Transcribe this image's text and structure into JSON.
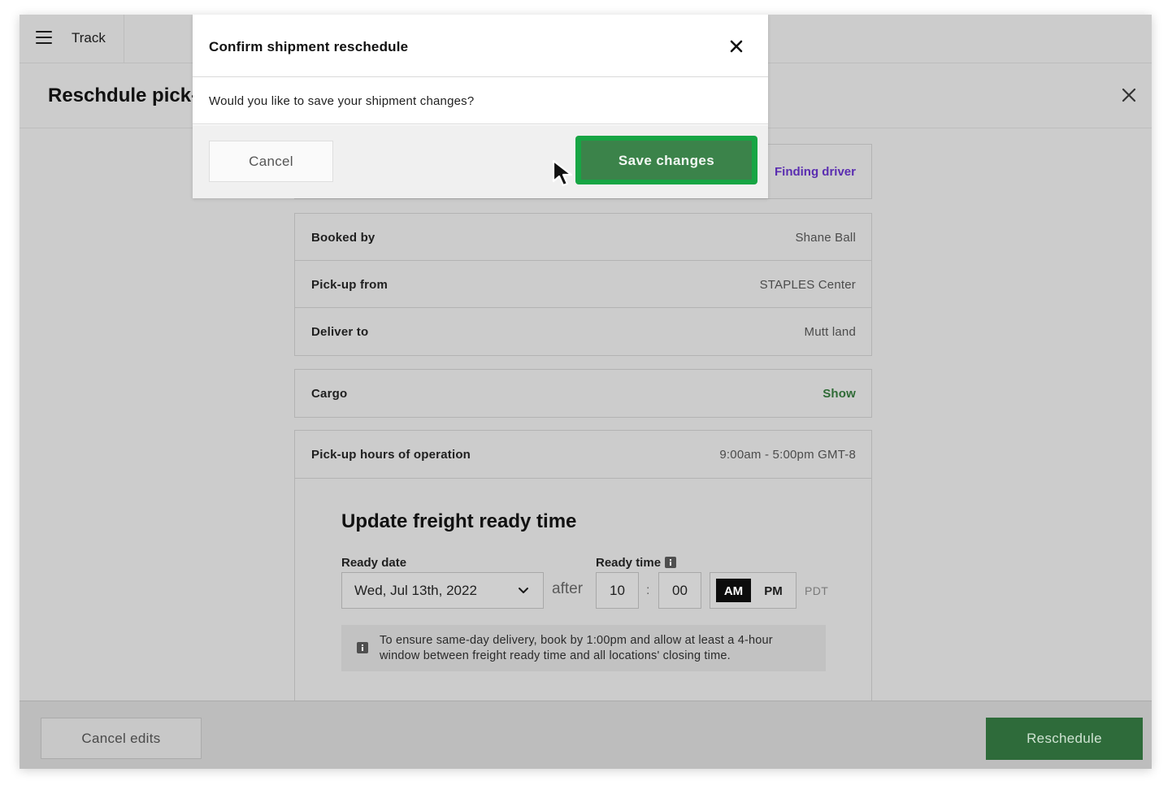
{
  "topbar": {
    "app_label": "Track"
  },
  "header": {
    "title": "Reschdule pick-up"
  },
  "status": {
    "value": "Finding driver",
    "color": "#5a2db0"
  },
  "shipment": {
    "rows": [
      {
        "label": "Booked by",
        "value": "Shane Ball"
      },
      {
        "label": "Pick-up from",
        "value": "STAPLES Center"
      },
      {
        "label": "Deliver to",
        "value": "Mutt land"
      }
    ]
  },
  "cargo": {
    "label": "Cargo",
    "action": "Show"
  },
  "hours": {
    "label": "Pick-up hours of operation",
    "value": "9:00am - 5:00pm GMT-8"
  },
  "freight": {
    "title": "Update freight ready time",
    "date_label": "Ready date",
    "date_value": "Wed, Jul 13th, 2022",
    "after_text": "after",
    "time_label": "Ready time",
    "hour": "10",
    "colon": ":",
    "minute": "00",
    "am": "AM",
    "pm": "PM",
    "selected_period": "AM",
    "timezone": "PDT",
    "info": "To ensure same-day delivery, book by 1:00pm and allow at least a 4-hour window between freight ready time and all locations' closing time."
  },
  "footer": {
    "cancel_label": "Cancel edits",
    "reschedule_label": "Reschedule"
  },
  "modal": {
    "title": "Confirm shipment reschedule",
    "message": "Would you like to save your shipment changes?",
    "cancel_label": "Cancel",
    "save_label": "Save changes"
  },
  "icons": {
    "menu": "hamburger-icon",
    "close": "close-icon",
    "chevron": "chevron-down-icon",
    "info": "info-icon",
    "cursor": "cursor-pointer-icon"
  },
  "colors": {
    "primary_green": "#2e6b3a",
    "save_green": "#3b834a",
    "highlight_green": "#17a544",
    "link_green": "#2f6b36"
  }
}
